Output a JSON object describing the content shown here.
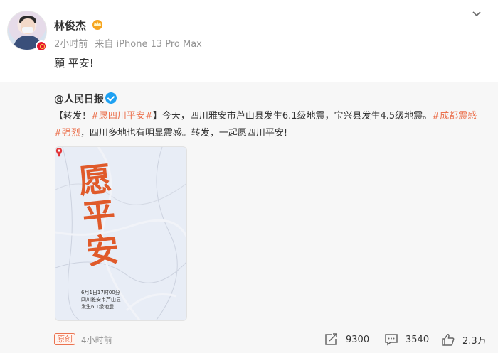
{
  "post": {
    "author": "林俊杰",
    "time": "2小时前",
    "source": "来自 iPhone 13 Pro Max",
    "text": "願 平安!"
  },
  "repost": {
    "author": "@人民日报",
    "text_prefix": "【转发！",
    "tag1": "#愿四川平安#",
    "text_mid": "】今天，四川雅安市芦山县发生6.1级地震，宝兴县发生4.5级地震。",
    "tag2": "#成都震感",
    "tag2b": "#强烈",
    "text_end": "，四川多地也有明显震感。转发，一起愿四川平安!",
    "image": {
      "calligraphy": "愿平安",
      "info_line1": "6月1日17时00分",
      "info_line2": "四川雅安市芦山县",
      "info_line3": "发生6.1级地震"
    },
    "original_label": "原创",
    "time": "4小时前",
    "stats": {
      "reposts": "9300",
      "comments": "3540",
      "likes": "2.3万"
    }
  },
  "colors": {
    "tag": "#eb7350",
    "verify_blue": "#1ea1f2",
    "badge_red": "#e6162d"
  },
  "icons": [
    "crown-icon",
    "chevron-down-icon",
    "verified-icon",
    "map-pin-icon",
    "repost-icon",
    "comment-icon",
    "like-icon"
  ]
}
